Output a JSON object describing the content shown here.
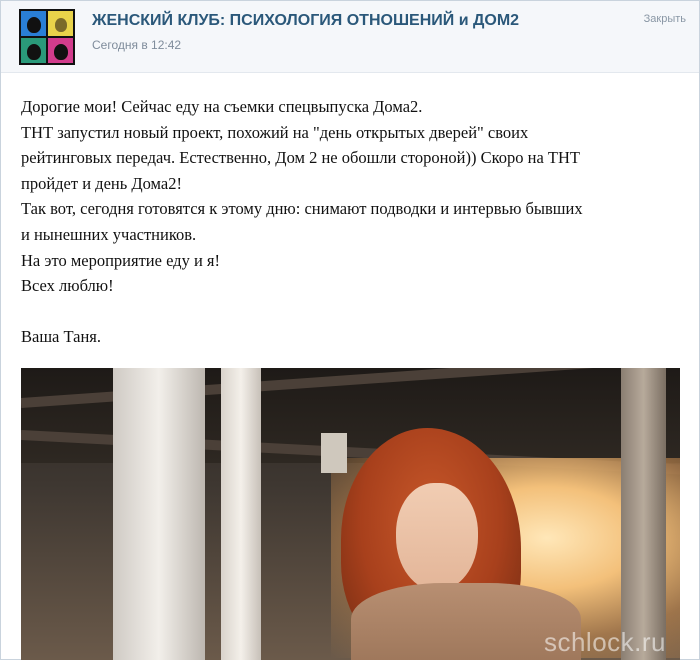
{
  "header": {
    "title": "ЖЕНСКИЙ КЛУБ: ПСИХОЛОГИЯ ОТНОШЕНИЙ и ДОМ2",
    "time": "Сегодня в 12:42",
    "close_label": "Закрыть"
  },
  "post": {
    "lines": [
      "Дорогие мои! Сейчас еду на съемки спецвыпуска Дома2.",
      "ТНТ запустил новый проект, похожий на \"день открытых дверей\" своих",
      "рейтинговых передач. Естественно, Дом 2 не обошли стороной)) Скоро на ТНТ",
      "пройдет и день Дома2!",
      "Так вот, сегодня готовятся к этому дню: снимают подводки и интервью бывших",
      "и нынешних участников.",
      "На это мероприятие еду и я!",
      "Всех люблю!"
    ],
    "signature": "Ваша Таня."
  },
  "photo": {
    "watermark": "schlock.ru"
  },
  "colors": {
    "title": "#2b587a",
    "time": "#7f8c9b",
    "header_bg": "#f5f7fa"
  }
}
